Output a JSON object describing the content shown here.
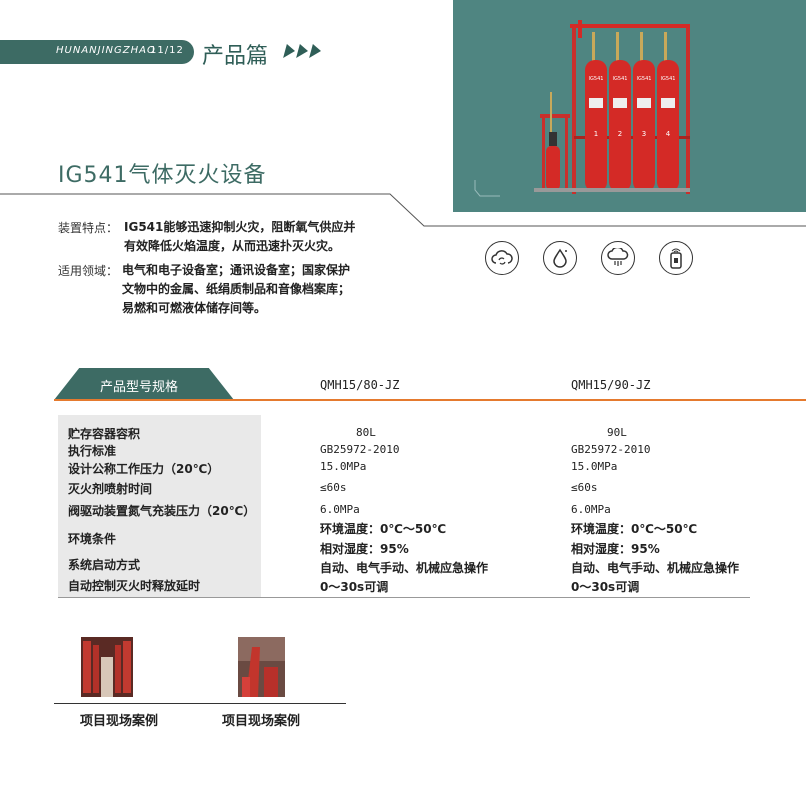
{
  "header": {
    "brand": "HUNANJINGZHAO",
    "page": "11/12",
    "section": "产品篇"
  },
  "product": {
    "title": "IG541气体灭火设备",
    "cylinder_labels": [
      "IG541",
      "IG541",
      "IG541",
      "IG541"
    ],
    "cylinder_numbers": [
      "1",
      "2",
      "3",
      "4"
    ]
  },
  "features": {
    "device_label": "装置特点：",
    "device_text_1": "IG541能够迅速抑制火灾，阻断氧气供应并",
    "device_text_2": "有效降低火焰温度，从而迅速扑灭火灾。",
    "scope_label": "适用领域：",
    "scope_text_1": "电气和电子设备室；通讯设备室；国家保护",
    "scope_text_2": "文物中的金属、纸绢质制品和音像档案库；",
    "scope_text_3": "易燃和可燃液体储存间等。"
  },
  "icons": [
    "cloud-sync-icon",
    "water-drop-icon",
    "cloud-rain-icon",
    "smart-device-icon"
  ],
  "spec": {
    "tab_label": "产品型号规格",
    "models": [
      "QMH15/80-JZ",
      "QMH15/90-JZ"
    ],
    "rows": [
      {
        "label": "贮存容器容积",
        "v1": "80L",
        "v2": "90L"
      },
      {
        "label": "执行标准",
        "v1": "GB25972-2010",
        "v2": "GB25972-2010"
      },
      {
        "label": "设计公称工作压力（20℃）",
        "v1": "15.0MPa",
        "v2": "15.0MPa"
      },
      {
        "label": "灭火剂喷射时间",
        "v1": "≤60s",
        "v2": "≤60s"
      },
      {
        "label": "阀驱动装置氮气充装压力（20℃）",
        "v1": "6.0MPa",
        "v2": "6.0MPa"
      },
      {
        "label": "环境条件",
        "v1a": "环境温度：0℃～50℃",
        "v1b": "相对湿度：95%",
        "v2a": "环境温度：0℃～50℃",
        "v2b": "相对湿度：95%"
      },
      {
        "label": "系统启动方式",
        "v1": "自动、电气手动、机械应急操作",
        "v2": "自动、电气手动、机械应急操作"
      },
      {
        "label": "自动控制灭火时释放延时",
        "v1": "0～30s可调",
        "v2": "0～30s可调"
      }
    ]
  },
  "cases": {
    "caption_1": "项目现场案例",
    "caption_2": "项目现场案例"
  },
  "colors": {
    "accent": "#3d6b64",
    "panel": "#4f8581",
    "rule": "#e57a2e",
    "cylinder": "#d42a26"
  }
}
